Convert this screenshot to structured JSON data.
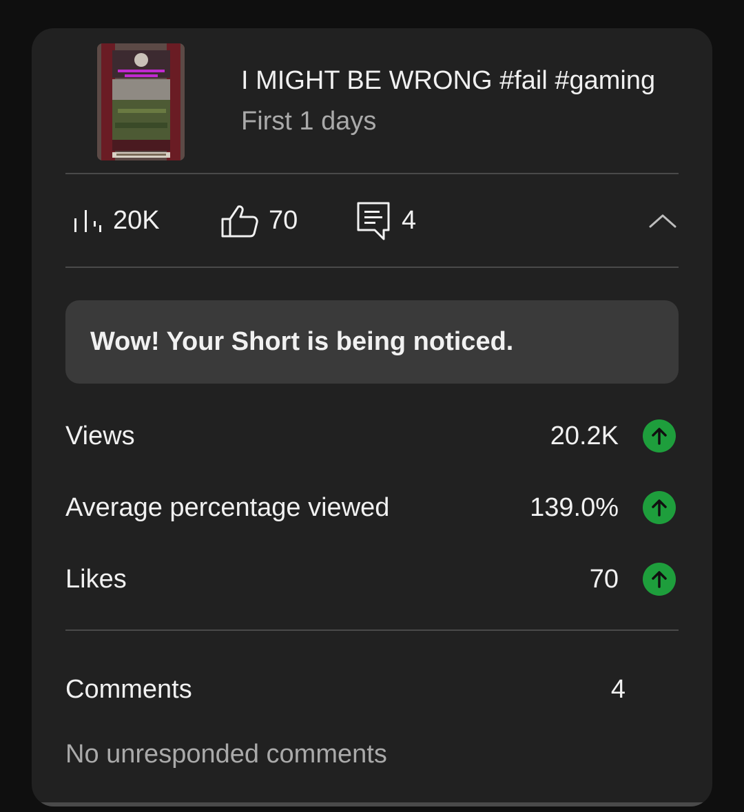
{
  "video": {
    "title": "I MIGHT BE WRONG #fail  #gaming",
    "period": "First 1 days",
    "thumbnail": "short-video-thumbnail"
  },
  "metrics": {
    "views": "20K",
    "likes": "70",
    "comments": "4",
    "views_icon": "bar-chart-icon",
    "likes_icon": "thumbs-up-icon",
    "comments_icon": "comment-icon",
    "collapse_icon": "chevron-up-icon"
  },
  "notice": {
    "text": "Wow! Your Short is being noticed."
  },
  "stats": [
    {
      "label": "Views",
      "value": "20.2K",
      "trend_icon": "arrow-up-icon"
    },
    {
      "label": "Average percentage viewed",
      "value": "139.0%",
      "trend_icon": "arrow-up-icon"
    },
    {
      "label": "Likes",
      "value": "70",
      "trend_icon": "arrow-up-icon"
    }
  ],
  "comments": {
    "label": "Comments",
    "value": "4",
    "status": "No unresponded comments"
  },
  "colors": {
    "background": "#0f0f0f",
    "card": "#212121",
    "notice_bg": "#3a3a3a",
    "trend_up": "#1e9e3c",
    "secondary_text": "#aaaaaa"
  }
}
